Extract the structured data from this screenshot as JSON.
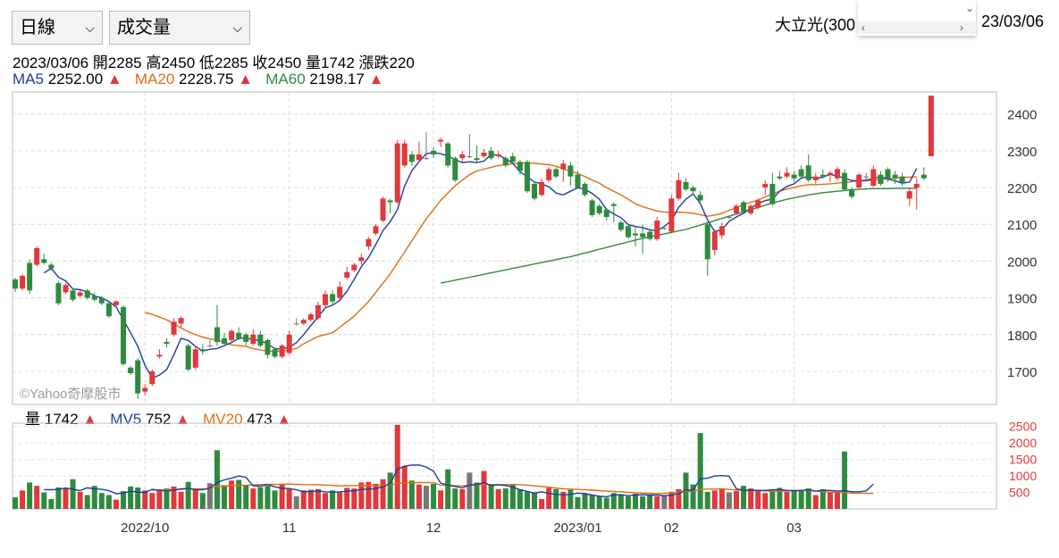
{
  "controls": {
    "period_select": "日線",
    "indicator_select": "成交量"
  },
  "stock": {
    "name": "大立光(300",
    "date": "23/03/06"
  },
  "ohlc": "2023/03/06 開2285 高2450 低2285 收2450 量1742 漲跌220",
  "ma": {
    "ma5_label": "MA5",
    "ma5_value": "2252.00",
    "ma20_label": "MA20",
    "ma20_value": "2228.75",
    "ma60_label": "MA60",
    "ma60_value": "2198.17",
    "arrow": "▲"
  },
  "vol_legend": {
    "vol_label": "量",
    "vol_value": "1742",
    "mv5_label": "MV5",
    "mv5_value": "752",
    "mv20_label": "MV20",
    "mv20_value": "473",
    "arrow": "▲"
  },
  "watermark": "©Yahoo奇摩股市",
  "colors": {
    "up": "#e0383c",
    "down": "#2e8b3e",
    "flat": "#777777",
    "ma5": "#1a3fa0",
    "ma20": "#e06d10",
    "ma60": "#2e8b3e"
  },
  "chart_data": {
    "type": "candlestick",
    "price_axis": {
      "ticks": [
        2400,
        2300,
        2200,
        2100,
        2000,
        1900,
        1800,
        1700
      ],
      "range": [
        1610,
        2460
      ]
    },
    "volume_axis": {
      "ticks": [
        2500,
        2000,
        1500,
        1000,
        500
      ],
      "range": [
        0,
        2600
      ]
    },
    "x_ticks": [
      {
        "label": "2022/10",
        "index": 18
      },
      {
        "label": "11",
        "index": 38
      },
      {
        "label": "12",
        "index": 58
      },
      {
        "label": "2023/01",
        "index": 78
      },
      {
        "label": "02",
        "index": 91
      },
      {
        "label": "03",
        "index": 108
      }
    ],
    "candles": [
      [
        1950,
        1925,
        1955,
        1915
      ],
      [
        1925,
        1960,
        1965,
        1920
      ],
      [
        1995,
        1920,
        2005,
        1910
      ],
      [
        1990,
        2035,
        2040,
        1985
      ],
      [
        2005,
        1995,
        2020,
        1990
      ],
      [
        1990,
        1980,
        1995,
        1975
      ],
      [
        1940,
        1885,
        1945,
        1880
      ],
      [
        1915,
        1935,
        1940,
        1910
      ],
      [
        1920,
        1895,
        1925,
        1890
      ],
      [
        1905,
        1915,
        1925,
        1900
      ],
      [
        1920,
        1900,
        1925,
        1895
      ],
      [
        1905,
        1895,
        1915,
        1890
      ],
      [
        1900,
        1885,
        1905,
        1880
      ],
      [
        1885,
        1850,
        1890,
        1845
      ],
      [
        1880,
        1890,
        1895,
        1875
      ],
      [
        1875,
        1720,
        1880,
        1715
      ],
      [
        1710,
        1695,
        1715,
        1690
      ],
      [
        1730,
        1640,
        1735,
        1625
      ],
      [
        1645,
        1655,
        1665,
        1635
      ],
      [
        1665,
        1700,
        1705,
        1660
      ],
      [
        1740,
        1745,
        1760,
        1735
      ],
      [
        1780,
        1775,
        1790,
        1765
      ],
      [
        1800,
        1835,
        1845,
        1795
      ],
      [
        1830,
        1845,
        1850,
        1820
      ],
      [
        1770,
        1705,
        1775,
        1700
      ],
      [
        1710,
        1760,
        1770,
        1705
      ],
      [
        1760,
        1755,
        1775,
        1745
      ],
      [
        1770,
        1770,
        1785,
        1765
      ],
      [
        1820,
        1780,
        1880,
        1770
      ],
      [
        1790,
        1775,
        1805,
        1770
      ],
      [
        1785,
        1810,
        1815,
        1780
      ],
      [
        1805,
        1790,
        1820,
        1785
      ],
      [
        1800,
        1780,
        1805,
        1770
      ],
      [
        1775,
        1800,
        1815,
        1770
      ],
      [
        1800,
        1770,
        1810,
        1765
      ],
      [
        1785,
        1745,
        1790,
        1735
      ],
      [
        1760,
        1740,
        1765,
        1735
      ],
      [
        1740,
        1770,
        1775,
        1735
      ],
      [
        1750,
        1800,
        1810,
        1745
      ],
      [
        1830,
        1830,
        1845,
        1825
      ],
      [
        1830,
        1840,
        1845,
        1825
      ],
      [
        1840,
        1855,
        1860,
        1835
      ],
      [
        1845,
        1880,
        1890,
        1840
      ],
      [
        1880,
        1910,
        1920,
        1875
      ],
      [
        1910,
        1890,
        1920,
        1880
      ],
      [
        1900,
        1930,
        1945,
        1895
      ],
      [
        1955,
        1970,
        1985,
        1950
      ],
      [
        1975,
        1990,
        1995,
        1970
      ],
      [
        2000,
        2010,
        2020,
        1990
      ],
      [
        2040,
        2060,
        2065,
        2030
      ],
      [
        2075,
        2095,
        2100,
        2070
      ],
      [
        2110,
        2170,
        2175,
        2105
      ],
      [
        2165,
        2160,
        2170,
        2130
      ],
      [
        2160,
        2320,
        2330,
        2155
      ],
      [
        2260,
        2320,
        2330,
        2255
      ],
      [
        2290,
        2270,
        2300,
        2260
      ],
      [
        2275,
        2290,
        2325,
        2270
      ],
      [
        2280,
        2280,
        2350,
        2275
      ],
      [
        2300,
        2290,
        2310,
        2280
      ],
      [
        2325,
        2330,
        2335,
        2310
      ],
      [
        2320,
        2260,
        2325,
        2255
      ],
      [
        2280,
        2220,
        2285,
        2215
      ],
      [
        2280,
        2290,
        2300,
        2270
      ],
      [
        2285,
        2285,
        2345,
        2280
      ],
      [
        2280,
        2275,
        2315,
        2270
      ],
      [
        2285,
        2295,
        2305,
        2280
      ],
      [
        2300,
        2280,
        2310,
        2275
      ],
      [
        2285,
        2290,
        2300,
        2280
      ],
      [
        2280,
        2260,
        2285,
        2255
      ],
      [
        2285,
        2270,
        2295,
        2265
      ],
      [
        2270,
        2245,
        2275,
        2235
      ],
      [
        2270,
        2190,
        2275,
        2185
      ],
      [
        2210,
        2170,
        2215,
        2165
      ],
      [
        2180,
        2215,
        2225,
        2175
      ],
      [
        2220,
        2250,
        2255,
        2215
      ],
      [
        2250,
        2230,
        2255,
        2225
      ],
      [
        2250,
        2265,
        2275,
        2215
      ],
      [
        2260,
        2230,
        2270,
        2205
      ],
      [
        2235,
        2200,
        2245,
        2195
      ],
      [
        2210,
        2180,
        2215,
        2175
      ],
      [
        2165,
        2125,
        2170,
        2120
      ],
      [
        2150,
        2130,
        2155,
        2125
      ],
      [
        2140,
        2120,
        2145,
        2110
      ],
      [
        2155,
        2150,
        2160,
        2105
      ],
      [
        2105,
        2085,
        2110,
        2080
      ],
      [
        2095,
        2065,
        2100,
        2060
      ],
      [
        2075,
        2070,
        2095,
        2040
      ],
      [
        2075,
        2065,
        2100,
        2020
      ],
      [
        2080,
        2060,
        2085,
        2055
      ],
      [
        2060,
        2110,
        2120,
        2055
      ],
      [
        2090,
        2090,
        2095,
        2085
      ],
      [
        2080,
        2170,
        2180,
        2075
      ],
      [
        2170,
        2220,
        2240,
        2165
      ],
      [
        2215,
        2195,
        2225,
        2190
      ],
      [
        2200,
        2190,
        2205,
        2180
      ],
      [
        2180,
        2165,
        2190,
        2160
      ],
      [
        2100,
        2005,
        2105,
        1960
      ],
      [
        2030,
        2080,
        2085,
        2015
      ],
      [
        2070,
        2095,
        2105,
        2060
      ],
      [
        2120,
        2120,
        2125,
        2115
      ],
      [
        2130,
        2150,
        2155,
        2125
      ],
      [
        2160,
        2135,
        2165,
        2130
      ],
      [
        2130,
        2150,
        2155,
        2125
      ],
      [
        2145,
        2165,
        2170,
        2140
      ],
      [
        2200,
        2210,
        2220,
        2180
      ],
      [
        2210,
        2155,
        2240,
        2150
      ],
      [
        2230,
        2225,
        2245,
        2220
      ],
      [
        2230,
        2240,
        2255,
        2225
      ],
      [
        2235,
        2225,
        2245,
        2215
      ],
      [
        2250,
        2230,
        2260,
        2225
      ],
      [
        2260,
        2220,
        2290,
        2215
      ],
      [
        2220,
        2230,
        2240,
        2210
      ],
      [
        2235,
        2230,
        2250,
        2225
      ],
      [
        2235,
        2240,
        2245,
        2215
      ],
      [
        2225,
        2250,
        2255,
        2220
      ],
      [
        2240,
        2195,
        2250,
        2190
      ],
      [
        2195,
        2175,
        2200,
        2170
      ],
      [
        2200,
        2235,
        2240,
        2195
      ],
      [
        2230,
        2230,
        2240,
        2220
      ],
      [
        2205,
        2250,
        2260,
        2200
      ],
      [
        2235,
        2210,
        2245,
        2205
      ],
      [
        2250,
        2225,
        2255,
        2215
      ],
      [
        2235,
        2225,
        2245,
        2210
      ],
      [
        2230,
        2215,
        2240,
        2205
      ],
      [
        2170,
        2190,
        2200,
        2150
      ],
      [
        2200,
        2210,
        2225,
        2140
      ],
      [
        2235,
        2225,
        2255,
        2220
      ],
      [
        2285,
        2450,
        2450,
        2285
      ]
    ],
    "volume": [
      350,
      560,
      800,
      700,
      500,
      300,
      650,
      620,
      900,
      520,
      420,
      700,
      480,
      420,
      280,
      540,
      680,
      650,
      560,
      480,
      560,
      620,
      680,
      520,
      820,
      620,
      480,
      780,
      1780,
      720,
      860,
      880,
      720,
      620,
      660,
      700,
      560,
      760,
      600,
      380,
      560,
      580,
      600,
      480,
      560,
      500,
      640,
      620,
      800,
      820,
      760,
      900,
      1100,
      2550,
      1300,
      860,
      740,
      700,
      760,
      560,
      1200,
      620,
      600,
      1100,
      800,
      1150,
      740,
      600,
      620,
      760,
      600,
      520,
      480,
      300,
      640,
      600,
      520,
      580,
      360,
      480,
      420,
      380,
      340,
      480,
      420,
      380,
      460,
      380,
      420,
      380,
      400,
      520,
      600,
      1100,
      740,
      2300,
      520,
      560,
      600,
      500,
      540,
      700,
      620,
      580,
      480,
      560,
      640,
      520,
      580,
      560,
      620,
      420,
      600,
      500,
      520,
      1740
    ],
    "ma5": [
      null,
      null,
      null,
      null,
      1968,
      1980,
      1956,
      1946,
      1924,
      1922,
      1916,
      1905,
      1900,
      1890,
      1875,
      1840,
      1805,
      1768,
      1716,
      1682,
      1690,
      1705,
      1745,
      1790,
      1784,
      1768,
      1755,
      1760,
      1762,
      1770,
      1778,
      1790,
      1790,
      1787,
      1783,
      1775,
      1762,
      1760,
      1766,
      1778,
      1800,
      1825,
      1848,
      1873,
      1880,
      1893,
      1918,
      1950,
      1985,
      2010,
      2045,
      2083,
      2107,
      2140,
      2204,
      2246,
      2270,
      2292,
      2295,
      2292,
      2286,
      2276,
      2268,
      2270,
      2268,
      2272,
      2290,
      2288,
      2278,
      2266,
      2243,
      2229,
      2215,
      2210,
      2202,
      2185,
      2180,
      2190,
      2200,
      2195,
      2184,
      2168,
      2140,
      2128,
      2118,
      2099,
      2094,
      2091,
      2085,
      2082,
      2094,
      2110,
      2146,
      2168,
      2183,
      2157,
      2112,
      2080,
      2086,
      2108,
      2120,
      2130,
      2144,
      2156,
      2165,
      2168,
      2190,
      2203,
      2210,
      2226,
      2230,
      2225,
      2228,
      2236,
      2231,
      2226,
      2219,
      2218,
      2220,
      2225,
      2230,
      2223,
      2218,
      2212,
      2215,
      2252
    ],
    "ma20": [
      null,
      null,
      null,
      null,
      null,
      null,
      null,
      null,
      null,
      null,
      null,
      null,
      null,
      null,
      null,
      null,
      null,
      null,
      1860,
      1855,
      1848,
      1840,
      1830,
      1818,
      1808,
      1800,
      1793,
      1788,
      1785,
      1778,
      1772,
      1770,
      1768,
      1762,
      1758,
      1755,
      1754,
      1755,
      1758,
      1762,
      1775,
      1785,
      1795,
      1800,
      1805,
      1820,
      1835,
      1850,
      1870,
      1890,
      1915,
      1940,
      1965,
      1995,
      2025,
      2055,
      2085,
      2115,
      2140,
      2165,
      2185,
      2205,
      2220,
      2235,
      2245,
      2250,
      2255,
      2260,
      2262,
      2265,
      2266,
      2267,
      2266,
      2264,
      2262,
      2258,
      2250,
      2245,
      2238,
      2230,
      2220,
      2212,
      2200,
      2190,
      2180,
      2168,
      2156,
      2148,
      2142,
      2136,
      2133,
      2132,
      2133,
      2132,
      2130,
      2126,
      2122,
      2125,
      2130,
      2138,
      2145,
      2153,
      2160,
      2166,
      2175,
      2183,
      2190,
      2196,
      2200,
      2205,
      2208,
      2208,
      2209,
      2210,
      2212,
      2214,
      2216,
      2218,
      2218,
      2220,
      2222,
      2224,
      2226,
      2228,
      2228,
      2229
    ],
    "ma60": [
      null,
      null,
      null,
      null,
      null,
      null,
      null,
      null,
      null,
      null,
      null,
      null,
      null,
      null,
      null,
      null,
      null,
      null,
      null,
      null,
      null,
      null,
      null,
      null,
      null,
      null,
      null,
      null,
      null,
      null,
      null,
      null,
      null,
      null,
      null,
      null,
      null,
      null,
      null,
      null,
      null,
      null,
      null,
      null,
      null,
      null,
      null,
      null,
      null,
      null,
      null,
      null,
      null,
      null,
      null,
      null,
      null,
      null,
      null,
      1940,
      1944,
      1948,
      1952,
      1956,
      1960,
      1964,
      1968,
      1972,
      1976,
      1980,
      1984,
      1988,
      1992,
      1996,
      2000,
      2004,
      2008,
      2012,
      2017,
      2022,
      2027,
      2032,
      2037,
      2042,
      2047,
      2052,
      2057,
      2062,
      2066,
      2070,
      2074,
      2078,
      2082,
      2086,
      2092,
      2098,
      2104,
      2110,
      2116,
      2122,
      2128,
      2134,
      2140,
      2146,
      2152,
      2158,
      2163,
      2168,
      2172,
      2176,
      2180,
      2183,
      2186,
      2188,
      2190,
      2192,
      2194,
      2195,
      2196,
      2197,
      2197,
      2197,
      2198,
      2198,
      2198,
      2198
    ],
    "mv5": [
      null,
      null,
      null,
      null,
      582,
      582,
      590,
      634,
      594,
      558,
      638,
      606,
      594,
      553,
      460,
      480,
      537,
      511,
      494,
      592,
      567,
      545,
      569,
      608,
      620,
      580,
      580,
      630,
      800,
      880,
      932,
      1000,
      960,
      700,
      690,
      740,
      670,
      626,
      616,
      580,
      520,
      526,
      548,
      518,
      508,
      517,
      537,
      552,
      589,
      600,
      611,
      673,
      773,
      1200,
      1300,
      1330,
      1332,
      1270,
      1144,
      782,
      720,
      680,
      638,
      720,
      740,
      800,
      708,
      728,
      710,
      660,
      580,
      530,
      480,
      520,
      470,
      440,
      430,
      440,
      480,
      460,
      420,
      384,
      370,
      420,
      430,
      400,
      422,
      428,
      420,
      420,
      400,
      418,
      460,
      576,
      568,
      914,
      930,
      1000,
      1010,
      992,
      606,
      562,
      570,
      560,
      560,
      580,
      586,
      560,
      550,
      560,
      580,
      540,
      560,
      560,
      540,
      556,
      520,
      520,
      548,
      752
    ],
    "mv20": [
      null,
      null,
      null,
      null,
      null,
      null,
      null,
      null,
      null,
      null,
      null,
      null,
      null,
      null,
      null,
      null,
      null,
      null,
      null,
      565,
      575,
      585,
      590,
      596,
      608,
      612,
      604,
      614,
      676,
      688,
      708,
      716,
      716,
      728,
      740,
      746,
      742,
      748,
      752,
      744,
      738,
      734,
      730,
      724,
      712,
      700,
      700,
      708,
      710,
      716,
      718,
      708,
      720,
      780,
      790,
      796,
      800,
      796,
      796,
      720,
      716,
      704,
      700,
      720,
      730,
      740,
      740,
      736,
      736,
      740,
      736,
      720,
      700,
      680,
      660,
      630,
      610,
      600,
      590,
      580,
      570,
      555,
      540,
      530,
      520,
      500,
      490,
      480,
      470,
      460,
      470,
      484,
      500,
      530,
      540,
      590,
      600,
      600,
      610,
      590,
      574,
      560,
      556,
      552,
      548,
      540,
      540,
      550,
      556,
      560,
      560,
      540,
      520,
      510,
      500,
      490,
      480,
      476,
      472,
      473
    ]
  }
}
